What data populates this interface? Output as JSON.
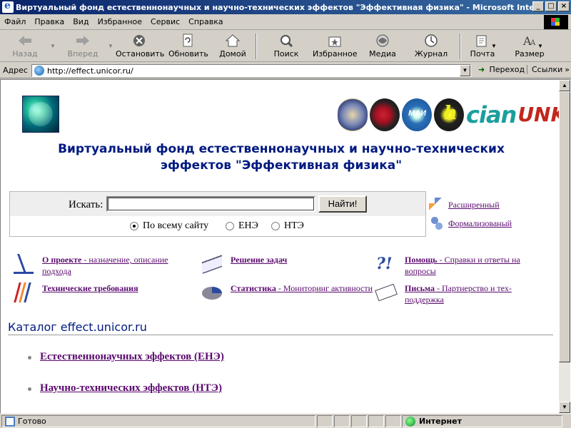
{
  "window": {
    "title": "Виртуальный фонд естественнонаучных и научно-технических эффектов \"Эффективная физика\" - Microsoft Internet Ex...",
    "minimize": "_",
    "maximize": "□",
    "close": "×"
  },
  "menubar": {
    "items": [
      "Файл",
      "Правка",
      "Вид",
      "Избранное",
      "Сервис",
      "Справка"
    ]
  },
  "toolbar": {
    "back": "Назад",
    "forward": "Вперед",
    "stop": "Остановить",
    "refresh": "Обновить",
    "home": "Домой",
    "search": "Поиск",
    "favorites": "Избранное",
    "media": "Медиа",
    "history": "Журнал",
    "mail": "Почта",
    "size": "Размер"
  },
  "addressbar": {
    "label": "Адрес",
    "url": "http://effect.unicor.ru/",
    "go": "Переход",
    "links": "Ссылки"
  },
  "page": {
    "title_line1": "Виртуальный фонд естественнонаучных и научно-технических",
    "title_line2": "эффектов \"Эффективная физика\"",
    "logos": {
      "cian": "cian",
      "unk": "UNK"
    },
    "search": {
      "label": "Искать:",
      "value": "",
      "button": "Найти!",
      "scopes": [
        "По всему сайту",
        "ЕНЭ",
        "НТЭ"
      ],
      "selected_scope": "По всему сайту"
    },
    "side_links": [
      "Расширенный",
      "Формализованый"
    ],
    "features": [
      {
        "title": "О проекте",
        "desc": " - назначение, описание подхода"
      },
      {
        "title": "Решение задач",
        "desc": ""
      },
      {
        "title": "Помощь",
        "desc": " - Справки и ответы на вопросы"
      },
      {
        "title": "Технические требования",
        "desc": ""
      },
      {
        "title": "Статистика",
        "desc": " - Мониторинг активности"
      },
      {
        "title": "Письма",
        "desc": " - Партнерство и тех-поддержка"
      }
    ],
    "catalog": {
      "title": "Каталог effect.unicor.ru",
      "items": [
        "Естественнонаучных эффектов (ЕНЭ)",
        "Научно-технических эффектов (НТЭ)"
      ]
    }
  },
  "statusbar": {
    "status": "Готово",
    "zone": "Интернет"
  }
}
